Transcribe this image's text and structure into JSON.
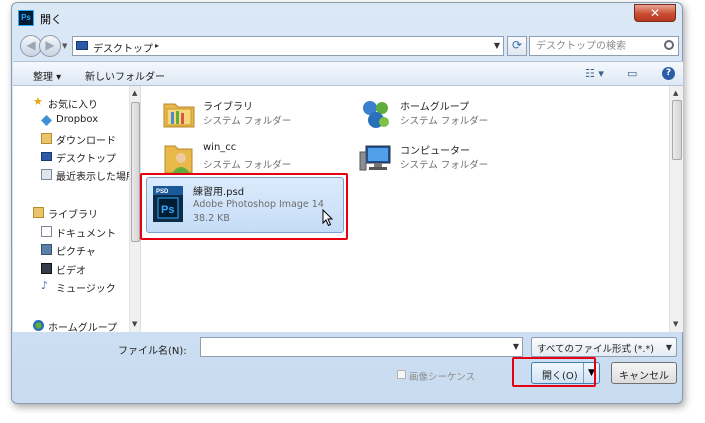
{
  "window": {
    "app_icon_text": "Ps",
    "title": "開く",
    "close_label": "✕"
  },
  "navbar": {
    "address_text": "デスクトップ",
    "search_placeholder": "デスクトップの検索"
  },
  "toolbar": {
    "organize_label": "整理 ▾",
    "new_folder_label": "新しいフォルダー",
    "help_label": "?"
  },
  "sidebar": {
    "items": [
      {
        "label": "お気に入り",
        "icon": "star-icon"
      },
      {
        "label": "Dropbox",
        "icon": "dropbox-icon"
      },
      {
        "label": "ダウンロード",
        "icon": "download-folder-icon"
      },
      {
        "label": "デスクトップ",
        "icon": "desktop-icon"
      },
      {
        "label": "最近表示した場所",
        "icon": "recent-places-icon"
      },
      {
        "label": "ライブラリ",
        "icon": "library-icon"
      },
      {
        "label": "ドキュメント",
        "icon": "documents-icon"
      },
      {
        "label": "ピクチャ",
        "icon": "pictures-icon"
      },
      {
        "label": "ビデオ",
        "icon": "videos-icon"
      },
      {
        "label": "ミュージック",
        "icon": "music-icon"
      },
      {
        "label": "ホームグループ",
        "icon": "homegroup-icon"
      }
    ]
  },
  "files": [
    {
      "name": "ライブラリ",
      "type": "システム フォルダー",
      "icon": "library-folder-icon"
    },
    {
      "name": "ホームグループ",
      "type": "システム フォルダー",
      "icon": "homegroup-icon"
    },
    {
      "name": "win_cc",
      "type": "システム フォルダー",
      "icon": "user-folder-icon"
    },
    {
      "name": "コンピューター",
      "type": "システム フォルダー",
      "icon": "computer-icon"
    },
    {
      "name": "練習用.psd",
      "type": "Adobe Photoshop Image 14",
      "size": "38.2 KB",
      "icon": "psd-file-icon",
      "selected": true
    }
  ],
  "bottom": {
    "filename_label": "ファイル名(N):",
    "filename_value": "",
    "filter_value": "すべてのファイル形式 (*.*)",
    "sequence_label": "画像シーケンス",
    "open_label": "開く(O)",
    "cancel_label": "キャンセル"
  },
  "colors": {
    "highlight_red": "#e60012",
    "selection_blue": "#c5dcf7"
  }
}
